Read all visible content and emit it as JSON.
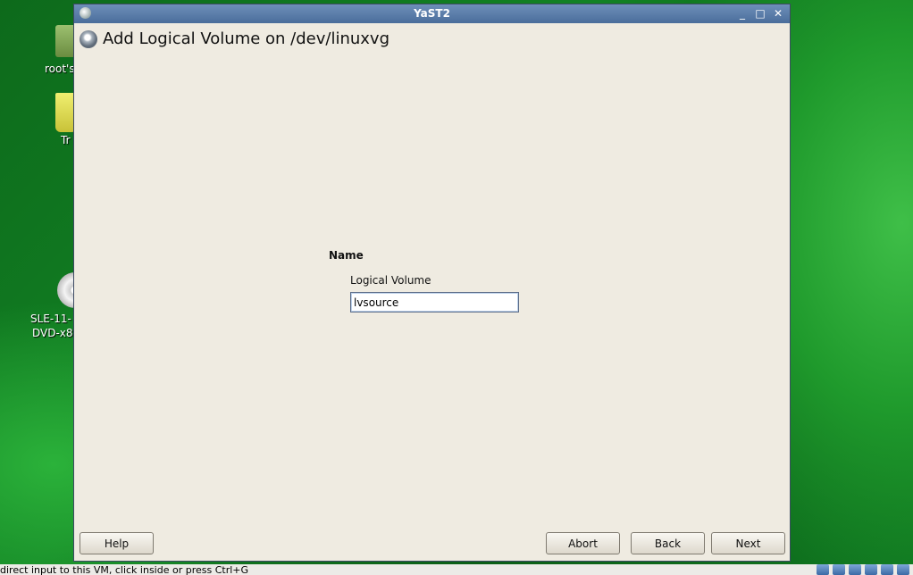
{
  "desktop": {
    "icons": [
      {
        "label": "root's",
        "icon": "home-folder-icon"
      },
      {
        "label": "Tr",
        "icon": "trash-icon"
      },
      {
        "label": "SLE-11-",
        "label2": "DVD-x8",
        "icon": "dvd-icon"
      }
    ]
  },
  "window": {
    "title": "YaST2",
    "controls": {
      "minimize": "_",
      "maximize": "□",
      "close": "✕"
    }
  },
  "dialog": {
    "heading": "Add Logical Volume on /dev/linuxvg",
    "section_label": "Name",
    "field_label": "Logical Volume",
    "field_value": "lvsource"
  },
  "buttons": {
    "help": "Help",
    "abort": "Abort",
    "back": "Back",
    "next": "Next"
  },
  "statusbar": {
    "message": "direct input to this VM, click inside or press Ctrl+G"
  },
  "colors": {
    "titlebar": "#4a6d9b",
    "dialog_bg": "#efebe1",
    "desktop": "#128224"
  }
}
